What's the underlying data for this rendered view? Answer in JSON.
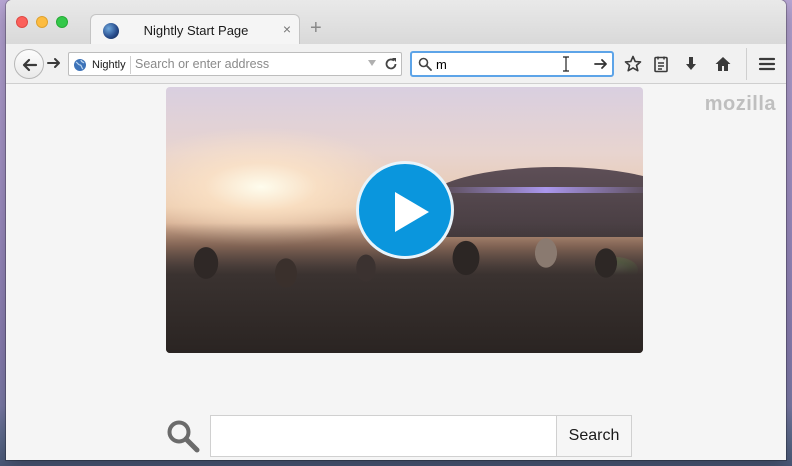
{
  "window": {
    "controls": [
      "close",
      "minimize",
      "maximize"
    ]
  },
  "tabs": [
    {
      "title": "Nightly Start Page",
      "favicon": "nightly-globe-icon",
      "close_glyph": "×"
    }
  ],
  "new_tab_glyph": "+",
  "navbar": {
    "identity_label": "Nightly",
    "url_placeholder": "Search or enter address",
    "url_value": "",
    "search_value": "m",
    "icons": [
      "back-arrow-icon",
      "forward-arrow-icon",
      "globe-icon",
      "dropdown-triangle-icon",
      "reload-icon",
      "search-icon",
      "go-arrow-icon",
      "bookmark-star-icon",
      "reading-list-icon",
      "download-arrow-icon",
      "home-icon",
      "hamburger-menu-icon"
    ]
  },
  "content": {
    "logo_text": "mozilla",
    "video": {
      "play_icon": "play-icon",
      "play_color": "#0a96dd"
    },
    "search": {
      "button_label": "Search",
      "input_value": "",
      "icon": "search-icon"
    }
  },
  "colors": {
    "search_focus": "#5da4e8",
    "play_button": "#0a96dd"
  }
}
